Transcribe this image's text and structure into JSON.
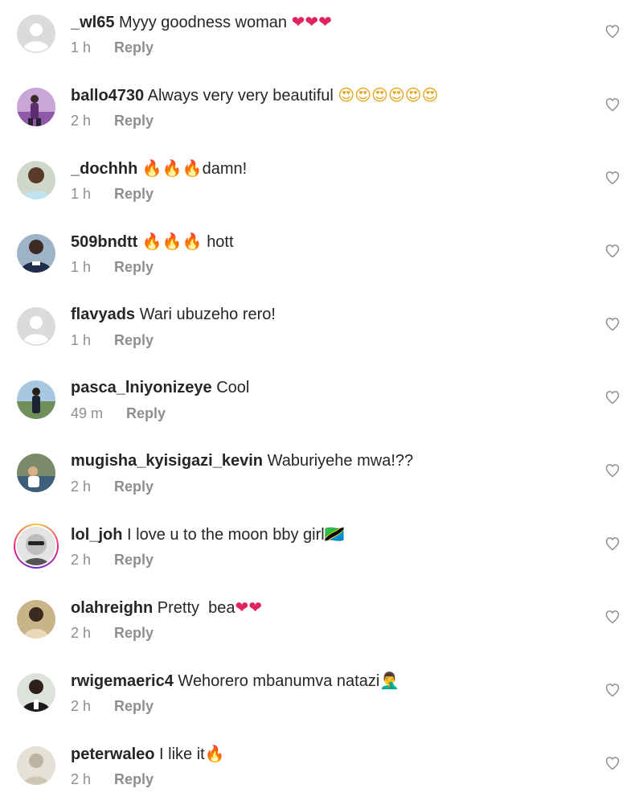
{
  "colors": {
    "text": "#262626",
    "muted": "#8e8e8e",
    "heart": "#e0245e",
    "fire": "#f4511e"
  },
  "comments": [
    {
      "username": "_wl65",
      "text": "Myyy goodness woman",
      "emoji": "❤❤❤",
      "time": "1 h",
      "reply": "Reply",
      "avatar": "default-avatar"
    },
    {
      "username": "ballo4730",
      "text": "Always very very beautiful",
      "emoji": "😍😍😍😍😍😍",
      "time": "2 h",
      "reply": "Reply",
      "avatar": "user-photo"
    },
    {
      "username": "_dochhh",
      "text": "damn!",
      "emoji": "🔥🔥🔥",
      "time": "1 h",
      "reply": "Reply",
      "avatar": "user-photo"
    },
    {
      "username": "509bndtt",
      "text": "hott",
      "emoji": "🔥🔥🔥",
      "time": "1 h",
      "reply": "Reply",
      "avatar": "user-photo"
    },
    {
      "username": "flavyads",
      "text": "Wari ubuzeho rero!",
      "emoji": "",
      "time": "1 h",
      "reply": "Reply",
      "avatar": "default-avatar"
    },
    {
      "username": "pasca_lniyonizeye",
      "text": "Cool",
      "emoji": "",
      "time": "49 m",
      "reply": "Reply",
      "avatar": "user-photo"
    },
    {
      "username": "mugisha_kyisigazi_kevin",
      "text": "Waburiyehe mwa!??",
      "emoji": "",
      "time": "2 h",
      "reply": "Reply",
      "avatar": "user-photo"
    },
    {
      "username": "lol_joh",
      "text": "I love u to the moon bby girl",
      "emoji": "🇹🇿",
      "time": "2 h",
      "reply": "Reply",
      "avatar": "story-ring"
    },
    {
      "username": "olahreighn",
      "text": "Pretty  bea",
      "emoji": "❤❤",
      "time": "2 h",
      "reply": "Reply",
      "avatar": "user-photo"
    },
    {
      "username": "rwigemaeric4",
      "text": "Wehorero mbanumva natazi",
      "emoji": "🤦‍♂️",
      "time": "2 h",
      "reply": "Reply",
      "avatar": "user-photo"
    },
    {
      "username": "peterwaleo",
      "text": "I like it",
      "emoji": "🔥",
      "time": "2 h",
      "reply": "Reply",
      "avatar": "user-photo"
    }
  ]
}
